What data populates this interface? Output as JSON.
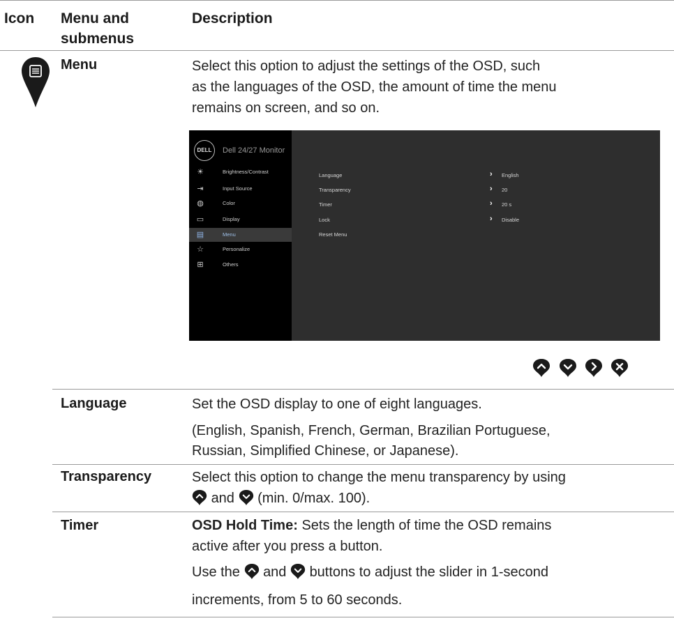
{
  "header": {
    "col_icon": "Icon",
    "col_menu_line1": "Menu and",
    "col_menu_line2": "submenus",
    "col_desc": "Description"
  },
  "menu_row": {
    "icon": "menu-list-pin-icon",
    "label": "Menu",
    "desc_lines": [
      "Select this option to adjust the settings of the OSD, such",
      "as the languages of the OSD, the amount of time the menu",
      "remains on screen, and so on."
    ]
  },
  "osd": {
    "logo": "DELL",
    "title": "Dell 24/27 Monitor",
    "sidebar": [
      {
        "icon": "brightness-icon",
        "glyph": "☀",
        "label": "Brightness/Contrast"
      },
      {
        "icon": "input-source-icon",
        "glyph": "⇥",
        "label": "Input Source"
      },
      {
        "icon": "color-icon",
        "glyph": "◍",
        "label": "Color"
      },
      {
        "icon": "display-icon",
        "glyph": "▭",
        "label": "Display"
      },
      {
        "icon": "menu-icon",
        "glyph": "▤",
        "label": "Menu",
        "selected": true
      },
      {
        "icon": "personalize-icon",
        "glyph": "☆",
        "label": "Personalize"
      },
      {
        "icon": "others-icon",
        "glyph": "⊞",
        "label": "Others"
      }
    ],
    "rows": [
      {
        "name": "Language",
        "value": "English"
      },
      {
        "name": "Transparency",
        "value": "20"
      },
      {
        "name": "Timer",
        "value": "20 s"
      },
      {
        "name": "Lock",
        "value": "Disable"
      },
      {
        "name": "Reset Menu",
        "value": ""
      }
    ]
  },
  "nav_buttons": [
    "up-button-icon",
    "down-button-icon",
    "right-button-icon",
    "close-button-icon"
  ],
  "language_row": {
    "label": "Language",
    "line1": "Set the OSD display to one of eight languages.",
    "line2": "(English, Spanish, French, German, Brazilian Portuguese,",
    "line3": "Russian, Simplified Chinese, or Japanese)."
  },
  "transparency_row": {
    "label": "Transparency",
    "line1": "Select this option to change the menu transparency by using",
    "and": "and",
    "tail": "(min. 0/max. 100)."
  },
  "timer_row": {
    "label": "Timer",
    "bold": "OSD Hold Time:",
    "line1_rest": "Sets the length of time the OSD remains",
    "line2": "active after you press a button.",
    "line3_a": "Use the",
    "line3_and": "and",
    "line3_b": "buttons to adjust the slider in 1-second",
    "line4": "increments, from 5 to 60 seconds."
  },
  "colors": {
    "pin": "#1a1a1a",
    "osd_bg": "#2e2e2e",
    "osd_side": "#000000",
    "osd_selected": "#8fb4e6"
  }
}
